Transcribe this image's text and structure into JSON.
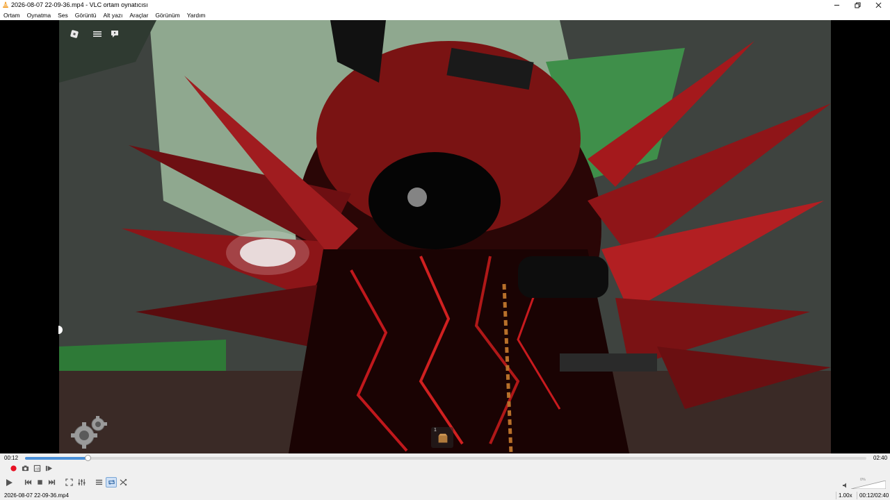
{
  "window": {
    "title": "2026-08-07 22-09-36.mp4 - VLC ortam oynatıcısı",
    "controls": [
      "minimize-icon",
      "maximize-icon",
      "close-icon"
    ]
  },
  "menubar": {
    "items": [
      "Ortam",
      "Oynatma",
      "Ses",
      "Görüntü",
      "Alt yazı",
      "Araçlar",
      "Görünüm",
      "Yardım"
    ]
  },
  "video_overlay": {
    "icons": [
      "roblox-logo-icon",
      "hamburger-menu-icon",
      "chat-icon",
      "settings-gear-icon",
      "backpack-icon"
    ],
    "hotbar_slot_number": "1"
  },
  "playback": {
    "elapsed": "00:12",
    "total": "02:40",
    "progress_fraction": 0.075,
    "accent_color": "#4a90d9"
  },
  "controls": {
    "row1": [
      "record-icon",
      "snapshot-icon",
      "loop-ab-icon",
      "frame-step-icon"
    ],
    "row2": [
      "play-icon",
      "previous-icon",
      "stop-icon",
      "next-icon",
      "fullscreen-icon",
      "extended-settings-icon",
      "playlist-icon",
      "loop-icon",
      "shuffle-icon"
    ],
    "record_color": "#e81123"
  },
  "volume": {
    "label": "0%",
    "level_fraction": 0.0
  },
  "statusbar": {
    "filename": "2026-08-07 22-09-36.mp4",
    "rate": "1.00x",
    "time": "00:12/02:40"
  }
}
